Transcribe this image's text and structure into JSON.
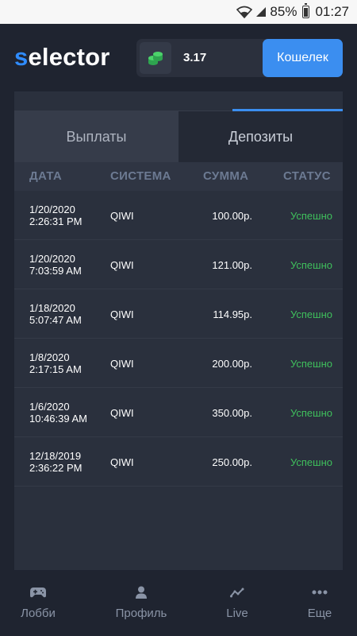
{
  "status_bar": {
    "battery": "85%",
    "time": "01:27"
  },
  "header": {
    "logo_first": "s",
    "logo_rest": "elector",
    "balance": "3.17",
    "wallet_button": "Кошелек"
  },
  "tabs": [
    {
      "label": "Выплаты",
      "active": true
    },
    {
      "label": "Депозиты",
      "active": false
    }
  ],
  "table": {
    "columns": [
      "ДАТА",
      "СИСТЕМА",
      "СУММА",
      "СТАТУС"
    ],
    "rows": [
      {
        "date": "1/20/2020 2:26:31 PM",
        "system": "QIWI",
        "amount": "100.00р.",
        "status": "Успешно"
      },
      {
        "date": "1/20/2020 7:03:59 AM",
        "system": "QIWI",
        "amount": "121.00р.",
        "status": "Успешно"
      },
      {
        "date": "1/18/2020 5:07:47 AM",
        "system": "QIWI",
        "amount": "114.95р.",
        "status": "Успешно"
      },
      {
        "date": "1/8/2020 2:17:15 AM",
        "system": "QIWI",
        "amount": "200.00р.",
        "status": "Успешно"
      },
      {
        "date": "1/6/2020 10:46:39 AM",
        "system": "QIWI",
        "amount": "350.00р.",
        "status": "Успешно"
      },
      {
        "date": "12/18/2019 2:36:22 PM",
        "system": "QIWI",
        "amount": "250.00р.",
        "status": "Успешно"
      }
    ]
  },
  "bottom_nav": [
    {
      "label": "Лобби",
      "icon": "gamepad-icon"
    },
    {
      "label": "Профиль",
      "icon": "user-icon"
    },
    {
      "label": "Live",
      "icon": "live-chart-icon"
    },
    {
      "label": "Еще",
      "icon": "more-dots-icon"
    }
  ],
  "colors": {
    "accent": "#3b8ef0",
    "success": "#3fbf5c",
    "background": "#1f2430",
    "panel": "#2a303d"
  }
}
